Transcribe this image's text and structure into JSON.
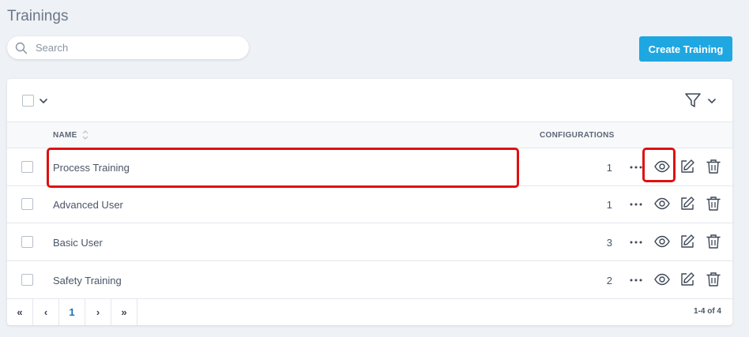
{
  "page": {
    "title": "Trainings"
  },
  "search": {
    "placeholder": "Search"
  },
  "toolbar": {
    "create_label": "Create Training"
  },
  "table": {
    "headers": {
      "name": "NAME",
      "configurations": "CONFIGURATIONS"
    },
    "rows": [
      {
        "name": "Process Training",
        "configurations": "1"
      },
      {
        "name": "Advanced User",
        "configurations": "1"
      },
      {
        "name": "Basic User",
        "configurations": "3"
      },
      {
        "name": "Safety Training",
        "configurations": "2"
      }
    ]
  },
  "pagination": {
    "first": "«",
    "prev": "‹",
    "current_page": "1",
    "next": "›",
    "last": "»",
    "range_text": "1-4 of 4"
  },
  "icons": {
    "search": "search-icon",
    "filter": "filter-icon",
    "sort": "sort-icon",
    "more": "more-icon",
    "view": "eye-icon",
    "edit": "edit-icon",
    "delete": "trash-icon"
  },
  "colors": {
    "accent": "#1ea7e1",
    "highlight": "#e01010",
    "background": "#eef1f5"
  }
}
